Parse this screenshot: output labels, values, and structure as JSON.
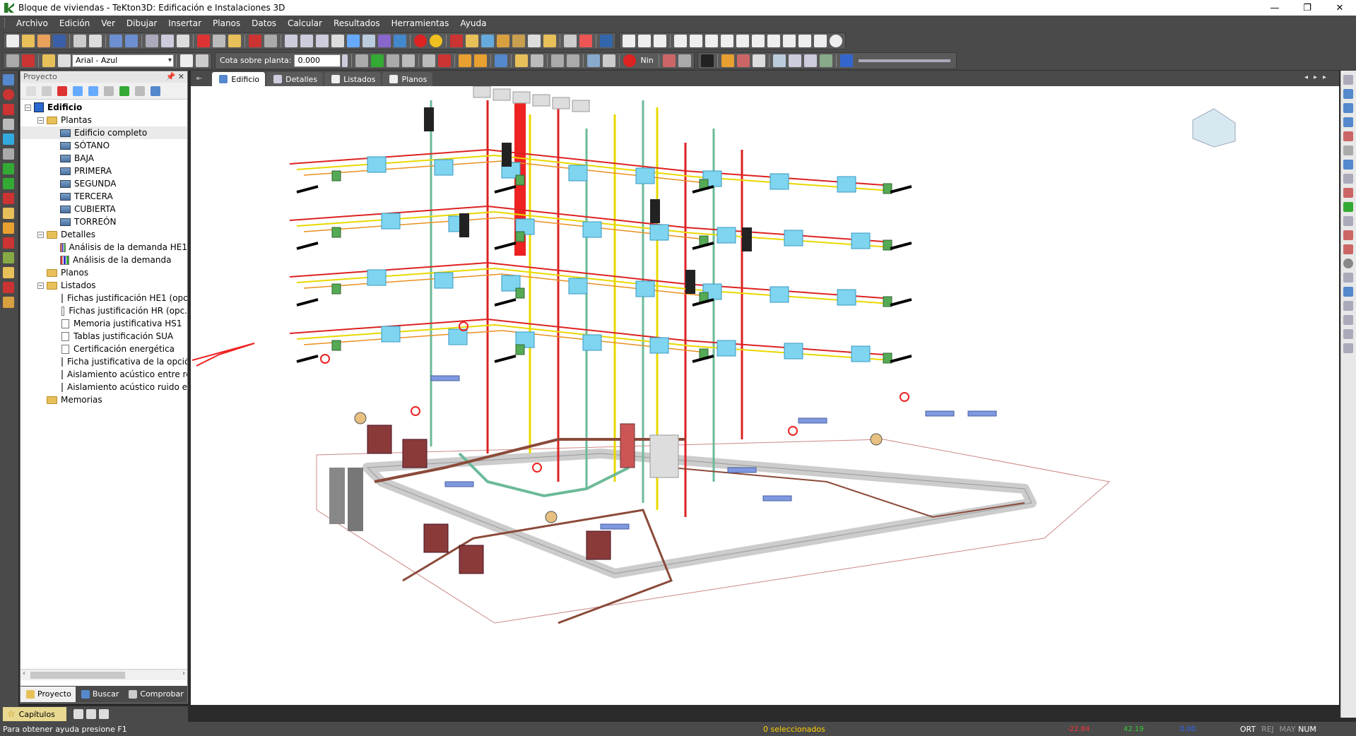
{
  "window": {
    "title": "Bloque de viviendas - TeKton3D: Edificación e Instalaciones 3D",
    "minimize": "—",
    "maximize": "❐",
    "close": "✕"
  },
  "menu": [
    "Archivo",
    "Edición",
    "Ver",
    "Dibujar",
    "Insertar",
    "Planos",
    "Datos",
    "Calcular",
    "Resultados",
    "Herramientas",
    "Ayuda"
  ],
  "toolbar": {
    "font_combo": "Arial - Azul",
    "cota_label": "Cota sobre planta:",
    "cota_value": "0.000",
    "nin_label": "Nin"
  },
  "panel": {
    "title": "Proyecto",
    "tree": {
      "root": "Edificio",
      "plantas": "Plantas",
      "plantas_items": [
        "Edificio completo",
        "SÓTANO",
        "BAJA",
        "PRIMERA",
        "SEGUNDA",
        "TERCERA",
        "CUBIERTA",
        "TORREÓN"
      ],
      "detalles": "Detalles",
      "detalles_items": [
        "Análisis de la demanda HE1",
        "Análisis de la demanda"
      ],
      "planos": "Planos",
      "listados": "Listados",
      "listados_items": [
        "Fichas justificación HE1 (opc",
        "Fichas justificación HR (opc.",
        "Memoria justificativa HS1",
        "Tablas justificación SUA",
        "Certificación energética",
        "Ficha justificativa de la opció",
        "Aislamiento acústico entre re",
        "Aislamiento acústico ruido e"
      ],
      "memorias": "Memorias"
    },
    "tabs": [
      "Proyecto",
      "Buscar",
      "Comprobar"
    ]
  },
  "capitulos": "Capítulos",
  "doc_tabs": [
    "Edificio",
    "Detalles",
    "Listados",
    "Planos"
  ],
  "status": {
    "help": "Para obtener ayuda presione F1",
    "selected": "0 seleccionados",
    "x": "-22.84",
    "y": "42.19",
    "z": "0.00",
    "flags": [
      "ORT",
      "REJ",
      "MAY",
      "NUM"
    ]
  },
  "colors": {
    "chrome": "#4a4a4a",
    "pipe_red": "#d22",
    "pipe_yellow": "#e8d800",
    "fixture_cyan": "#7fd4f0",
    "pipe_green": "#6cba98",
    "pipe_brown": "#8b4a3a"
  }
}
